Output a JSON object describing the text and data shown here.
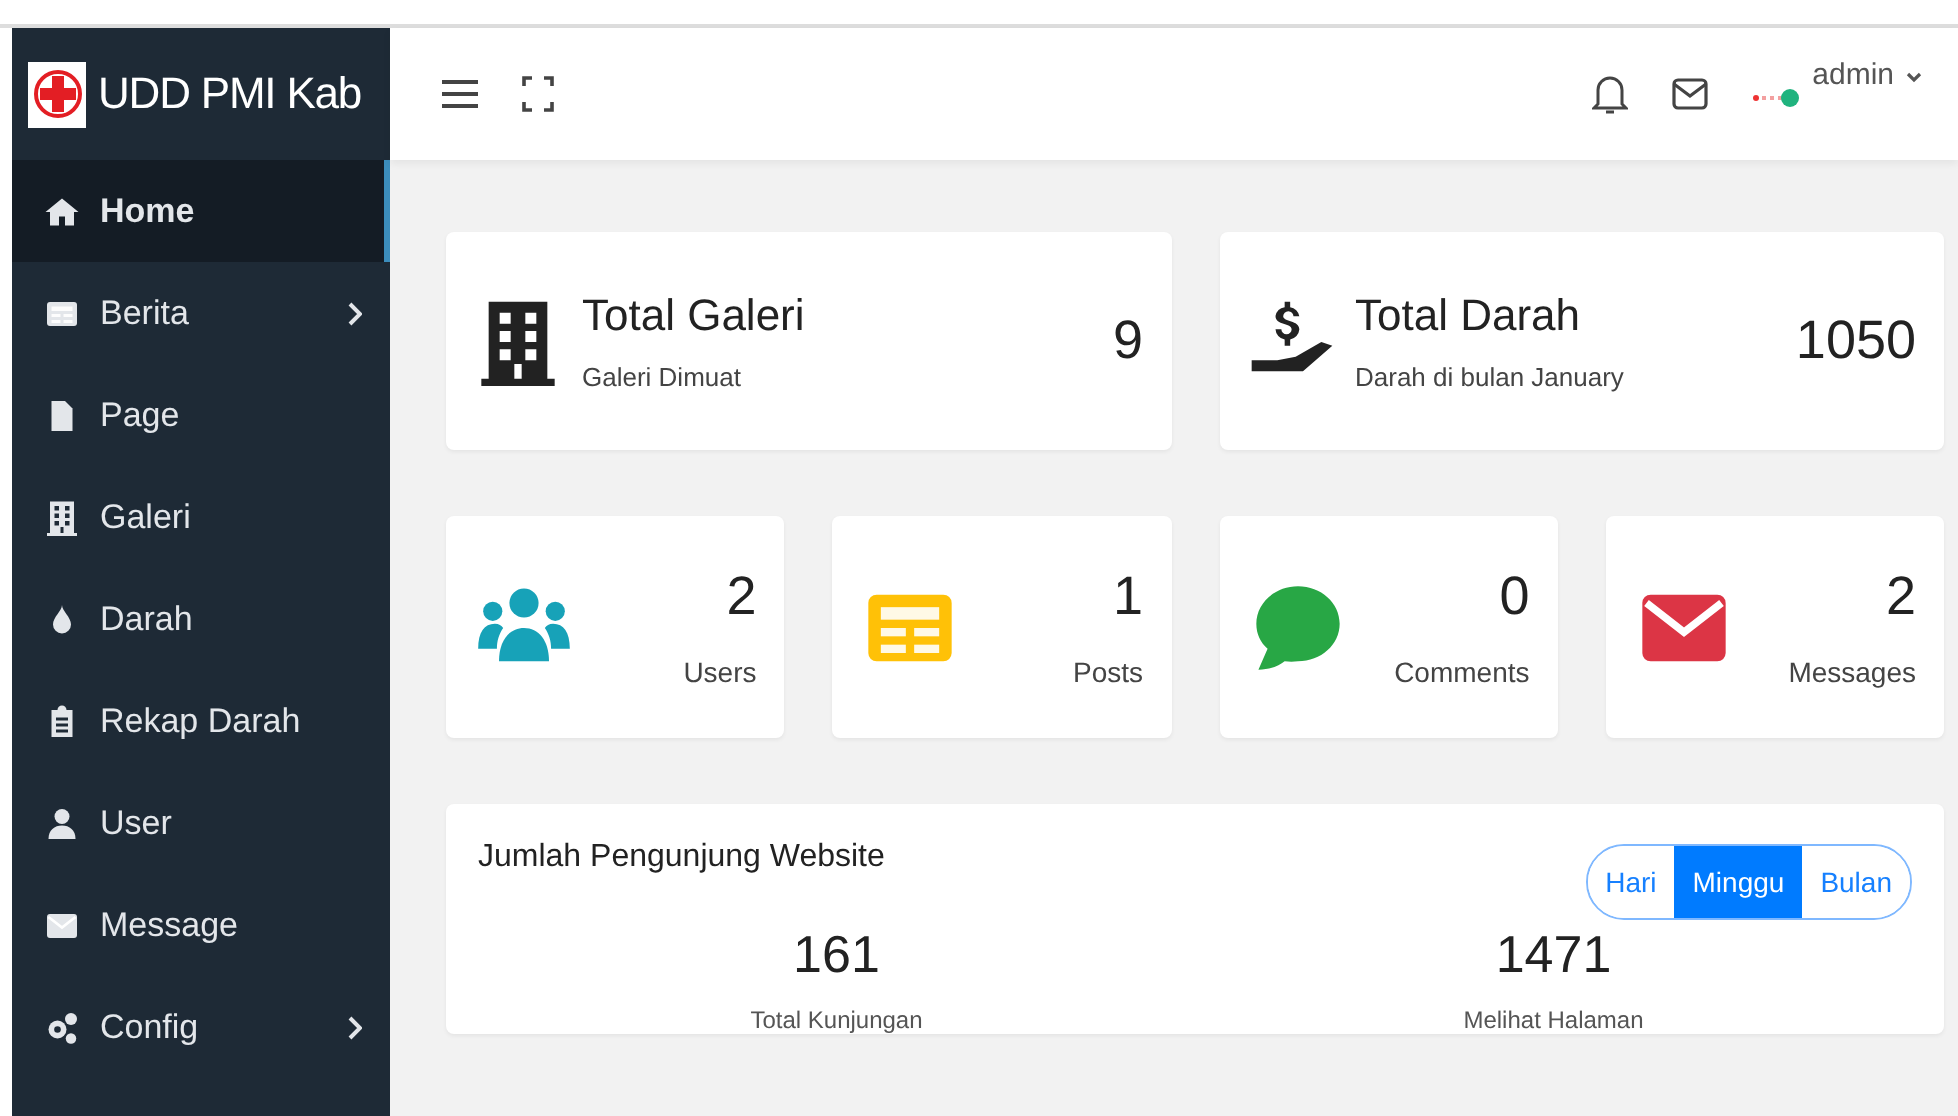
{
  "brand": {
    "title": "UDD PMI Kab"
  },
  "sidebar": {
    "items": [
      {
        "label": "Home",
        "selected": true,
        "has_submenu": false
      },
      {
        "label": "Berita",
        "selected": false,
        "has_submenu": true
      },
      {
        "label": "Page",
        "selected": false,
        "has_submenu": false
      },
      {
        "label": "Galeri",
        "selected": false,
        "has_submenu": false
      },
      {
        "label": "Darah",
        "selected": false,
        "has_submenu": false
      },
      {
        "label": "Rekap Darah",
        "selected": false,
        "has_submenu": false
      },
      {
        "label": "User",
        "selected": false,
        "has_submenu": false
      },
      {
        "label": "Message",
        "selected": false,
        "has_submenu": false
      },
      {
        "label": "Config",
        "selected": false,
        "has_submenu": true
      }
    ]
  },
  "header": {
    "user": "admin"
  },
  "summary_cards": [
    {
      "title": "Total Galeri",
      "subtitle": "Galeri Dimuat",
      "value": "9"
    },
    {
      "title": "Total Darah",
      "subtitle": "Darah di bulan January",
      "value": "1050"
    }
  ],
  "stat_cards": [
    {
      "value": "2",
      "label": "Users",
      "color": "#17a2b8"
    },
    {
      "value": "1",
      "label": "Posts",
      "color": "#ffc107"
    },
    {
      "value": "0",
      "label": "Comments",
      "color": "#28a745"
    },
    {
      "value": "2",
      "label": "Messages",
      "color": "#dc3545"
    }
  ],
  "visitors": {
    "title": "Jumlah Pengunjung Website",
    "periods": [
      {
        "label": "Hari",
        "selected": false
      },
      {
        "label": "Minggu",
        "selected": true
      },
      {
        "label": "Bulan",
        "selected": false
      }
    ],
    "metrics": [
      {
        "value": "161",
        "label": "Total Kunjungan"
      },
      {
        "value": "1471",
        "label": "Melihat Halaman"
      }
    ]
  }
}
